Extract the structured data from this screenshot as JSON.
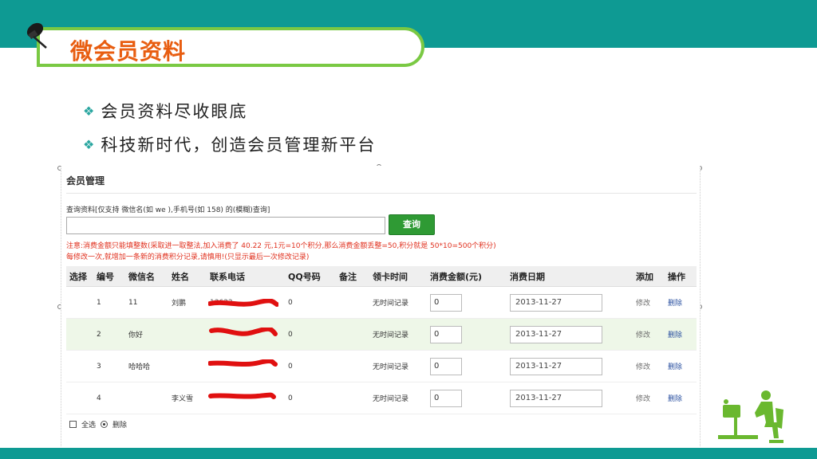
{
  "slide": {
    "title": "微会员资料",
    "bullets": [
      "会员资料尽收眼底",
      "科技新时代，创造会员管理新平台"
    ],
    "colors": {
      "band": "#0e9a93",
      "title_text": "#e85d10",
      "pill_border": "#7ac943"
    }
  },
  "screenshot": {
    "page_title": "会员管理",
    "query_label": "查询资料[仅支持 微信名(如 we ),手机号(如 158) 的(模糊)查询]",
    "query_input_value": "",
    "query_button": "查询",
    "notice_line1": "注意:消费金额只能填整数(采取进一取整法,加入消费了 40.22 元,1元=10个积分,那么消费金额丢整=50,积分就是 50*10=500个积分)",
    "notice_line2": "每修改一次,就增加一条新的消费积分记录,请慎用!(只显示最后一次修改记录)",
    "columns": [
      "选择",
      "编号",
      "微信名",
      "姓名",
      "联系电话",
      "QQ号码",
      "备注",
      "领卡时间",
      "消费金额(元)",
      "消费日期",
      "添加",
      "操作"
    ],
    "rows": [
      {
        "id": "1",
        "wechat": "11",
        "name": "刘鹏",
        "phone": "13633",
        "qq": "0",
        "note": "",
        "card_time": "无时间记录",
        "amount": "0",
        "date": "2013-11-27",
        "add": "修改",
        "op": "删除"
      },
      {
        "id": "2",
        "wechat": "你好",
        "name": "",
        "phone": "",
        "qq": "0",
        "note": "",
        "card_time": "无时间记录",
        "amount": "0",
        "date": "2013-11-27",
        "add": "修改",
        "op": "删除"
      },
      {
        "id": "3",
        "wechat": "哈哈哈",
        "name": "",
        "phone": "",
        "qq": "0",
        "note": "",
        "card_time": "无时间记录",
        "amount": "0",
        "date": "2013-11-27",
        "add": "修改",
        "op": "删除"
      },
      {
        "id": "4",
        "wechat": "",
        "name": "李义雪",
        "phone": "",
        "qq": "0",
        "note": "",
        "card_time": "无时间记录",
        "amount": "0",
        "date": "2013-11-27",
        "add": "修改",
        "op": "删除"
      }
    ],
    "footer_select_all": "全选",
    "footer_delete": "删除"
  }
}
